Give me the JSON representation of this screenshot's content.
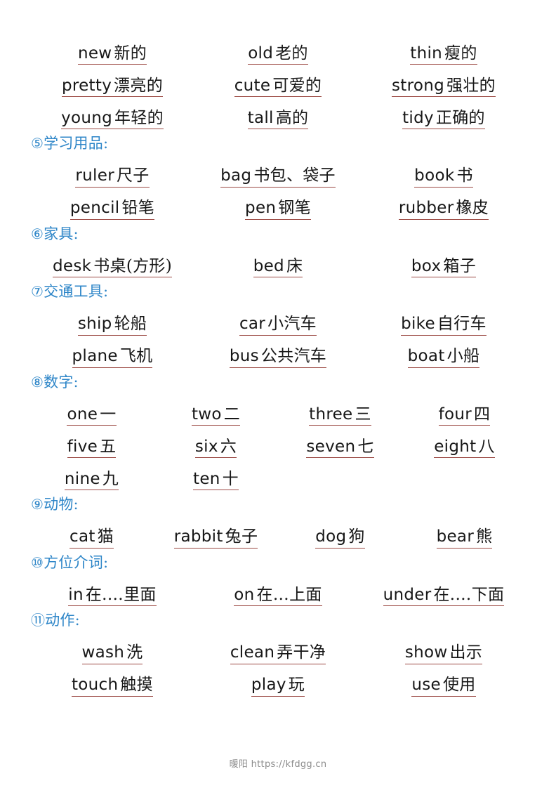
{
  "document": {
    "background_color": "#ffffff",
    "heading_color": "#2e86c8",
    "underline_color": "#9c4a44",
    "text_color": "#171717"
  },
  "sections": [
    {
      "id": "adjectives",
      "heading": null,
      "columns": 3,
      "rows": [
        [
          {
            "en": "new",
            "zh": "新的"
          },
          {
            "en": "old",
            "zh": "老的"
          },
          {
            "en": "thin",
            "zh": "瘦的"
          }
        ],
        [
          {
            "en": "pretty",
            "zh": "漂亮的"
          },
          {
            "en": "cute",
            "zh": "可爱的"
          },
          {
            "en": "strong",
            "zh": "强壮的"
          }
        ],
        [
          {
            "en": "young",
            "zh": "年轻的"
          },
          {
            "en": "tall",
            "zh": "高的"
          },
          {
            "en": "tidy",
            "zh": "正确的"
          }
        ]
      ]
    },
    {
      "id": "stationery",
      "heading": {
        "num": "⑤",
        "label": "学习用品:"
      },
      "columns": 3,
      "rows": [
        [
          {
            "en": "ruler",
            "zh": "尺子"
          },
          {
            "en": "bag",
            "zh": "书包、袋子"
          },
          {
            "en": "book",
            "zh": "书"
          }
        ],
        [
          {
            "en": "pencil",
            "zh": "铅笔"
          },
          {
            "en": "pen",
            "zh": "钢笔"
          },
          {
            "en": "rubber",
            "zh": "橡皮"
          }
        ]
      ]
    },
    {
      "id": "furniture",
      "heading": {
        "num": "⑥",
        "label": "家具:"
      },
      "columns": 3,
      "rows": [
        [
          {
            "en": "desk",
            "zh": "书桌(方形)"
          },
          {
            "en": "bed",
            "zh": "床"
          },
          {
            "en": "box",
            "zh": "箱子"
          }
        ]
      ]
    },
    {
      "id": "transport",
      "heading": {
        "num": "⑦",
        "label": "交通工具:"
      },
      "columns": 3,
      "rows": [
        [
          {
            "en": "ship",
            "zh": "轮船"
          },
          {
            "en": "car",
            "zh": "小汽车"
          },
          {
            "en": "bike",
            "zh": "自行车"
          }
        ],
        [
          {
            "en": "plane",
            "zh": "飞机"
          },
          {
            "en": "bus",
            "zh": "公共汽车"
          },
          {
            "en": "boat",
            "zh": "小船"
          }
        ]
      ]
    },
    {
      "id": "numbers",
      "heading": {
        "num": "⑧",
        "label": "数字:"
      },
      "columns": 4,
      "rows": [
        [
          {
            "en": "one",
            "zh": "一"
          },
          {
            "en": "two",
            "zh": "二"
          },
          {
            "en": "three",
            "zh": "三"
          },
          {
            "en": "four",
            "zh": "四"
          }
        ],
        [
          {
            "en": "five",
            "zh": "五"
          },
          {
            "en": "six",
            "zh": "六"
          },
          {
            "en": "seven",
            "zh": "七"
          },
          {
            "en": "eight",
            "zh": "八"
          }
        ],
        [
          {
            "en": "nine",
            "zh": "九"
          },
          {
            "en": "ten",
            "zh": "十"
          },
          null,
          null
        ]
      ]
    },
    {
      "id": "animals",
      "heading": {
        "num": "⑨",
        "label": "动物:"
      },
      "columns": 4,
      "rows": [
        [
          {
            "en": "cat",
            "zh": "猫"
          },
          {
            "en": "rabbit",
            "zh": "兔子"
          },
          {
            "en": "dog",
            "zh": "狗"
          },
          {
            "en": "bear",
            "zh": "熊"
          }
        ]
      ]
    },
    {
      "id": "prepositions",
      "heading": {
        "num": "⑩",
        "label": "方位介词:"
      },
      "columns": 3,
      "rows": [
        [
          {
            "en": "in",
            "zh": "在.…里面"
          },
          {
            "en": "on",
            "zh": "在…上面"
          },
          {
            "en": "under",
            "zh": "在.…下面"
          }
        ]
      ]
    },
    {
      "id": "actions",
      "heading": {
        "num": "⑪",
        "label": "动作:"
      },
      "columns": 3,
      "rows": [
        [
          {
            "en": "wash",
            "zh": "洗"
          },
          {
            "en": "clean",
            "zh": "弄干净"
          },
          {
            "en": "show",
            "zh": "出示"
          }
        ],
        [
          {
            "en": "touch",
            "zh": "触摸"
          },
          {
            "en": "play",
            "zh": "玩"
          },
          {
            "en": "use",
            "zh": "使用"
          }
        ]
      ]
    }
  ],
  "footer": {
    "text": "暖阳 https://kfdgg.cn"
  }
}
